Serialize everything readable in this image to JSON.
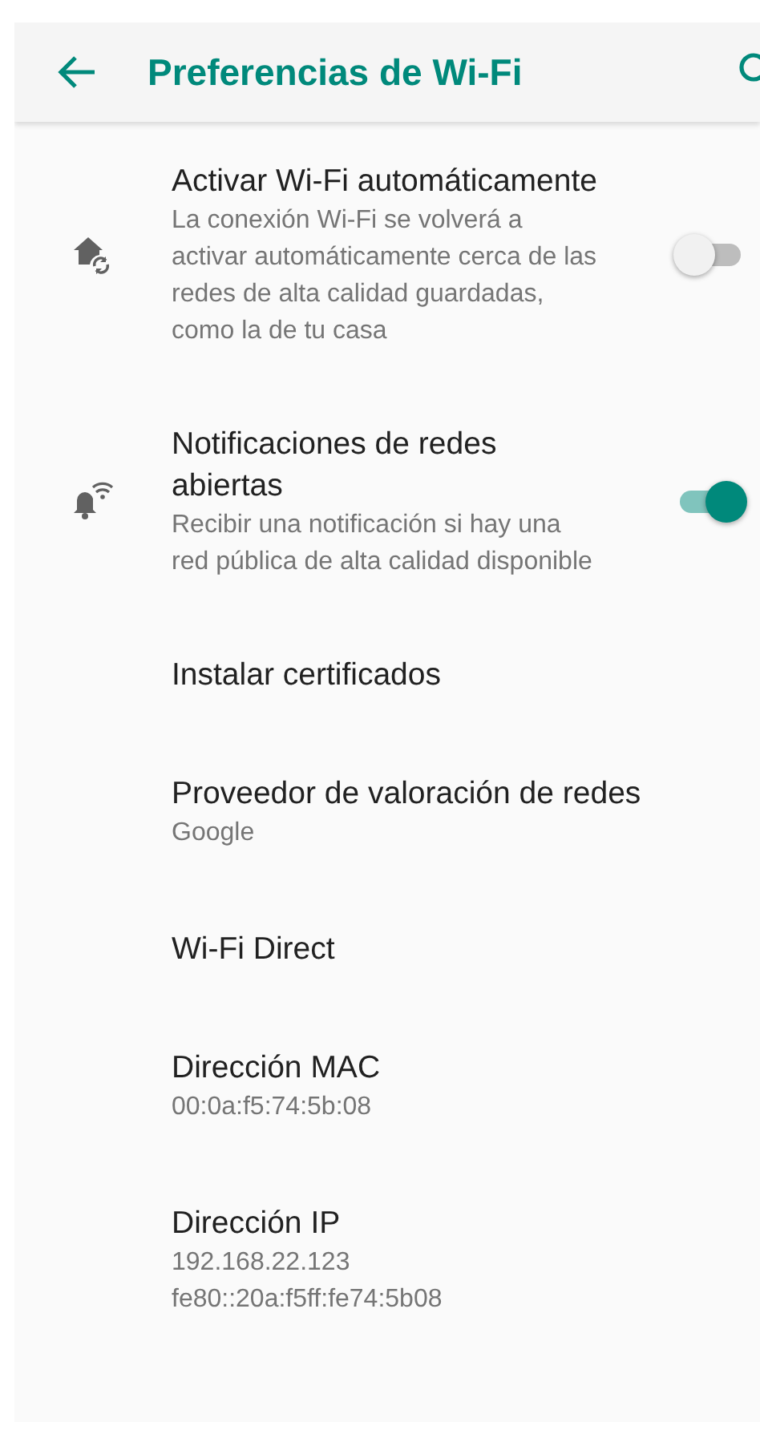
{
  "toolbar": {
    "title": "Preferencias de Wi-Fi"
  },
  "items": [
    {
      "kind": "toggle",
      "title": "Activar Wi-Fi automáticamente",
      "summary": [
        "La conexión Wi-Fi se volverá a activar automáticamente cerca de las redes de alta calidad guardadas, como la de tu casa"
      ],
      "on": false
    },
    {
      "kind": "toggle",
      "title": "Notificaciones de redes abiertas",
      "summary": [
        "Recibir una notificación si hay una red pública de alta calidad disponible"
      ],
      "on": true
    },
    {
      "kind": "plain",
      "title": "Instalar certificados"
    },
    {
      "kind": "plain",
      "title": "Proveedor de valoración de redes",
      "summary": [
        "Google"
      ]
    },
    {
      "kind": "plain",
      "title": "Wi-Fi Direct"
    },
    {
      "kind": "plain",
      "title": "Dirección MAC",
      "summary": [
        "00:0a:f5:74:5b:08"
      ]
    },
    {
      "kind": "plain",
      "title": "Dirección IP",
      "summary": [
        "192.168.22.123",
        "fe80::20a:f5ff:fe74:5b08"
      ]
    }
  ]
}
